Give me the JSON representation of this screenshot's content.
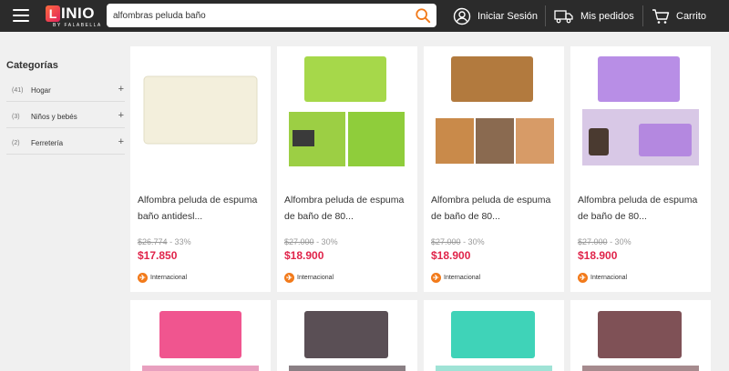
{
  "header": {
    "logo_text": "LINIO",
    "logo_sub": "BY FALABELLA",
    "search_value": "alfombras peluda baño",
    "login_label": "Iniciar Sesión",
    "orders_label": "Mis pedidos",
    "cart_label": "Carrito"
  },
  "sidebar": {
    "title": "Categorías",
    "items": [
      {
        "count": "(41)",
        "label": "Hogar"
      },
      {
        "count": "(3)",
        "label": "Niños y bebés"
      },
      {
        "count": "(2)",
        "label": "Ferretería"
      }
    ]
  },
  "products": [
    {
      "title": "Alfombra peluda de espuma baño antidesl...",
      "old_price": "$26.774",
      "discount": "- 33%",
      "price": "$17.850",
      "badge": "Internacional",
      "color": "#f3efdc"
    },
    {
      "title": "Alfombra peluda de espuma de baño de 80...",
      "old_price": "$27.000",
      "discount": "- 30%",
      "price": "$18.900",
      "badge": "Internacional",
      "color": "#a6d84a"
    },
    {
      "title": "Alfombra peluda de espuma de baño de 80...",
      "old_price": "$27.000",
      "discount": "- 30%",
      "price": "$18.900",
      "badge": "Internacional",
      "color": "#b27a3e"
    },
    {
      "title": "Alfombra peluda de espuma de baño de 80...",
      "old_price": "$27.000",
      "discount": "- 30%",
      "price": "$18.900",
      "badge": "Internacional",
      "color": "#b88ee6"
    },
    {
      "color": "#f0558f"
    },
    {
      "color": "#5a4f55"
    },
    {
      "color": "#3fd3b8"
    },
    {
      "color": "#7f5156"
    }
  ],
  "colors": {
    "header_bg": "#2b2b2b",
    "price": "#e0244a",
    "badge": "#f27a1a",
    "search_icon": "#f27a1a"
  }
}
